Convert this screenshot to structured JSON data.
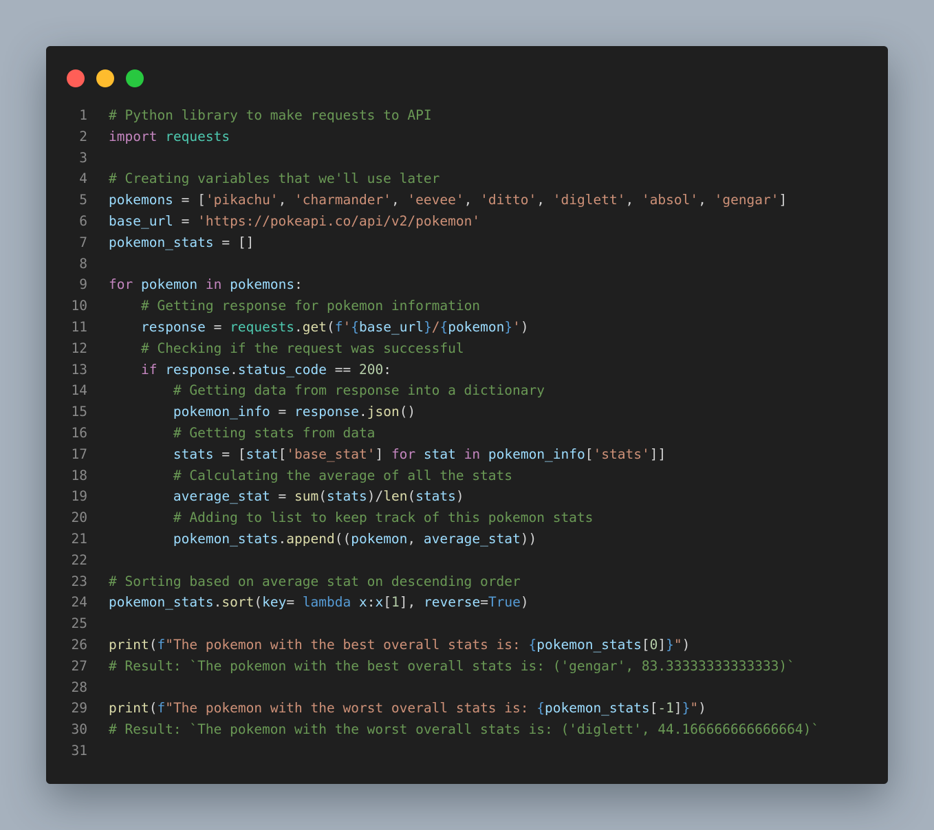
{
  "window": {
    "traffic_lights": [
      {
        "name": "close",
        "color": "#ff5f57"
      },
      {
        "name": "minimize",
        "color": "#febc2e"
      },
      {
        "name": "maximize",
        "color": "#28c840"
      }
    ]
  },
  "theme": {
    "background": "#1f1f1f",
    "comment": "#6a9955",
    "keyword": "#c586c0",
    "module": "#4ec9b0",
    "variable": "#9cdcfe",
    "string": "#ce9178",
    "function": "#dcdcaa",
    "number": "#b5cea8",
    "builtin": "#569cd6",
    "plain": "#d4d4d4"
  },
  "code": {
    "lines": [
      {
        "n": "1",
        "tokens": [
          [
            "c",
            "# Python library to make requests to API"
          ]
        ]
      },
      {
        "n": "2",
        "tokens": [
          [
            "k",
            "import"
          ],
          [
            "p",
            " "
          ],
          [
            "m",
            "requests"
          ]
        ]
      },
      {
        "n": "3",
        "tokens": []
      },
      {
        "n": "4",
        "tokens": [
          [
            "c",
            "# Creating variables that we'll use later"
          ]
        ]
      },
      {
        "n": "5",
        "tokens": [
          [
            "v",
            "pokemons"
          ],
          [
            "p",
            " = ["
          ],
          [
            "s",
            "'pikachu'"
          ],
          [
            "p",
            ", "
          ],
          [
            "s",
            "'charmander'"
          ],
          [
            "p",
            ", "
          ],
          [
            "s",
            "'eevee'"
          ],
          [
            "p",
            ", "
          ],
          [
            "s",
            "'ditto'"
          ],
          [
            "p",
            ", "
          ],
          [
            "s",
            "'diglett'"
          ],
          [
            "p",
            ", "
          ],
          [
            "s",
            "'absol'"
          ],
          [
            "p",
            ", "
          ],
          [
            "s",
            "'gengar'"
          ],
          [
            "p",
            "]"
          ]
        ]
      },
      {
        "n": "6",
        "tokens": [
          [
            "v",
            "base_url"
          ],
          [
            "p",
            " = "
          ],
          [
            "s",
            "'https://pokeapi.co/api/v2/pokemon'"
          ]
        ]
      },
      {
        "n": "7",
        "tokens": [
          [
            "v",
            "pokemon_stats"
          ],
          [
            "p",
            " = []"
          ]
        ]
      },
      {
        "n": "8",
        "tokens": []
      },
      {
        "n": "9",
        "tokens": [
          [
            "k",
            "for"
          ],
          [
            "p",
            " "
          ],
          [
            "v",
            "pokemon"
          ],
          [
            "p",
            " "
          ],
          [
            "k",
            "in"
          ],
          [
            "p",
            " "
          ],
          [
            "v",
            "pokemons"
          ],
          [
            "p",
            ":"
          ]
        ]
      },
      {
        "n": "10",
        "tokens": [
          [
            "p",
            "    "
          ],
          [
            "c",
            "# Getting response for pokemon information"
          ]
        ]
      },
      {
        "n": "11",
        "tokens": [
          [
            "p",
            "    "
          ],
          [
            "v",
            "response"
          ],
          [
            "p",
            " = "
          ],
          [
            "m",
            "requests"
          ],
          [
            "p",
            "."
          ],
          [
            "f",
            "get"
          ],
          [
            "p",
            "("
          ],
          [
            "b",
            "f"
          ],
          [
            "s",
            "'"
          ],
          [
            "b",
            "{"
          ],
          [
            "v",
            "base_url"
          ],
          [
            "b",
            "}"
          ],
          [
            "s",
            "/"
          ],
          [
            "b",
            "{"
          ],
          [
            "v",
            "pokemon"
          ],
          [
            "b",
            "}"
          ],
          [
            "s",
            "'"
          ],
          [
            "p",
            ")"
          ]
        ]
      },
      {
        "n": "12",
        "tokens": [
          [
            "p",
            "    "
          ],
          [
            "c",
            "# Checking if the request was successful"
          ]
        ]
      },
      {
        "n": "13",
        "tokens": [
          [
            "p",
            "    "
          ],
          [
            "k",
            "if"
          ],
          [
            "p",
            " "
          ],
          [
            "v",
            "response"
          ],
          [
            "p",
            "."
          ],
          [
            "v",
            "status_code"
          ],
          [
            "p",
            " == "
          ],
          [
            "n",
            "200"
          ],
          [
            "p",
            ":"
          ]
        ]
      },
      {
        "n": "14",
        "tokens": [
          [
            "p",
            "        "
          ],
          [
            "c",
            "# Getting data from response into a dictionary"
          ]
        ]
      },
      {
        "n": "15",
        "tokens": [
          [
            "p",
            "        "
          ],
          [
            "v",
            "pokemon_info"
          ],
          [
            "p",
            " = "
          ],
          [
            "v",
            "response"
          ],
          [
            "p",
            "."
          ],
          [
            "f",
            "json"
          ],
          [
            "p",
            "()"
          ]
        ]
      },
      {
        "n": "16",
        "tokens": [
          [
            "p",
            "        "
          ],
          [
            "c",
            "# Getting stats from data"
          ]
        ]
      },
      {
        "n": "17",
        "tokens": [
          [
            "p",
            "        "
          ],
          [
            "v",
            "stats"
          ],
          [
            "p",
            " = ["
          ],
          [
            "v",
            "stat"
          ],
          [
            "p",
            "["
          ],
          [
            "s",
            "'base_stat'"
          ],
          [
            "p",
            "] "
          ],
          [
            "k",
            "for"
          ],
          [
            "p",
            " "
          ],
          [
            "v",
            "stat"
          ],
          [
            "p",
            " "
          ],
          [
            "k",
            "in"
          ],
          [
            "p",
            " "
          ],
          [
            "v",
            "pokemon_info"
          ],
          [
            "p",
            "["
          ],
          [
            "s",
            "'stats'"
          ],
          [
            "p",
            "]]"
          ]
        ]
      },
      {
        "n": "18",
        "tokens": [
          [
            "p",
            "        "
          ],
          [
            "c",
            "# Calculating the average of all the stats"
          ]
        ]
      },
      {
        "n": "19",
        "tokens": [
          [
            "p",
            "        "
          ],
          [
            "v",
            "average_stat"
          ],
          [
            "p",
            " = "
          ],
          [
            "f",
            "sum"
          ],
          [
            "p",
            "("
          ],
          [
            "v",
            "stats"
          ],
          [
            "p",
            ")/"
          ],
          [
            "f",
            "len"
          ],
          [
            "p",
            "("
          ],
          [
            "v",
            "stats"
          ],
          [
            "p",
            ")"
          ]
        ]
      },
      {
        "n": "20",
        "tokens": [
          [
            "p",
            "        "
          ],
          [
            "c",
            "# Adding to list to keep track of this pokemon stats"
          ]
        ]
      },
      {
        "n": "21",
        "tokens": [
          [
            "p",
            "        "
          ],
          [
            "v",
            "pokemon_stats"
          ],
          [
            "p",
            "."
          ],
          [
            "f",
            "append"
          ],
          [
            "p",
            "(("
          ],
          [
            "v",
            "pokemon"
          ],
          [
            "p",
            ", "
          ],
          [
            "v",
            "average_stat"
          ],
          [
            "p",
            "))"
          ]
        ]
      },
      {
        "n": "22",
        "tokens": []
      },
      {
        "n": "23",
        "tokens": [
          [
            "c",
            "# Sorting based on average stat on descending order"
          ]
        ]
      },
      {
        "n": "24",
        "tokens": [
          [
            "v",
            "pokemon_stats"
          ],
          [
            "p",
            "."
          ],
          [
            "f",
            "sort"
          ],
          [
            "p",
            "("
          ],
          [
            "v",
            "key"
          ],
          [
            "p",
            "= "
          ],
          [
            "b",
            "lambda"
          ],
          [
            "p",
            " "
          ],
          [
            "v",
            "x"
          ],
          [
            "p",
            ":"
          ],
          [
            "v",
            "x"
          ],
          [
            "p",
            "["
          ],
          [
            "n",
            "1"
          ],
          [
            "p",
            "], "
          ],
          [
            "v",
            "reverse"
          ],
          [
            "p",
            "="
          ],
          [
            "b",
            "True"
          ],
          [
            "p",
            ")"
          ]
        ]
      },
      {
        "n": "25",
        "tokens": []
      },
      {
        "n": "26",
        "tokens": [
          [
            "f",
            "print"
          ],
          [
            "p",
            "("
          ],
          [
            "b",
            "f"
          ],
          [
            "s",
            "\"The pokemon with the best overall stats is: "
          ],
          [
            "b",
            "{"
          ],
          [
            "v",
            "pokemon_stats"
          ],
          [
            "p",
            "["
          ],
          [
            "n",
            "0"
          ],
          [
            "p",
            "]"
          ],
          [
            "b",
            "}"
          ],
          [
            "s",
            "\""
          ],
          [
            "p",
            ")"
          ]
        ]
      },
      {
        "n": "27",
        "tokens": [
          [
            "c",
            "# Result: `The pokemon with the best overall stats is: ('gengar', 83.33333333333333)`"
          ]
        ]
      },
      {
        "n": "28",
        "tokens": []
      },
      {
        "n": "29",
        "tokens": [
          [
            "f",
            "print"
          ],
          [
            "p",
            "("
          ],
          [
            "b",
            "f"
          ],
          [
            "s",
            "\"The pokemon with the worst overall stats is: "
          ],
          [
            "b",
            "{"
          ],
          [
            "v",
            "pokemon_stats"
          ],
          [
            "p",
            "["
          ],
          [
            "n",
            "-1"
          ],
          [
            "p",
            "]"
          ],
          [
            "b",
            "}"
          ],
          [
            "s",
            "\""
          ],
          [
            "p",
            ")"
          ]
        ]
      },
      {
        "n": "30",
        "tokens": [
          [
            "c",
            "# Result: `The pokemon with the worst overall stats is: ('diglett', 44.166666666666664)`"
          ]
        ]
      },
      {
        "n": "31",
        "tokens": []
      }
    ]
  }
}
